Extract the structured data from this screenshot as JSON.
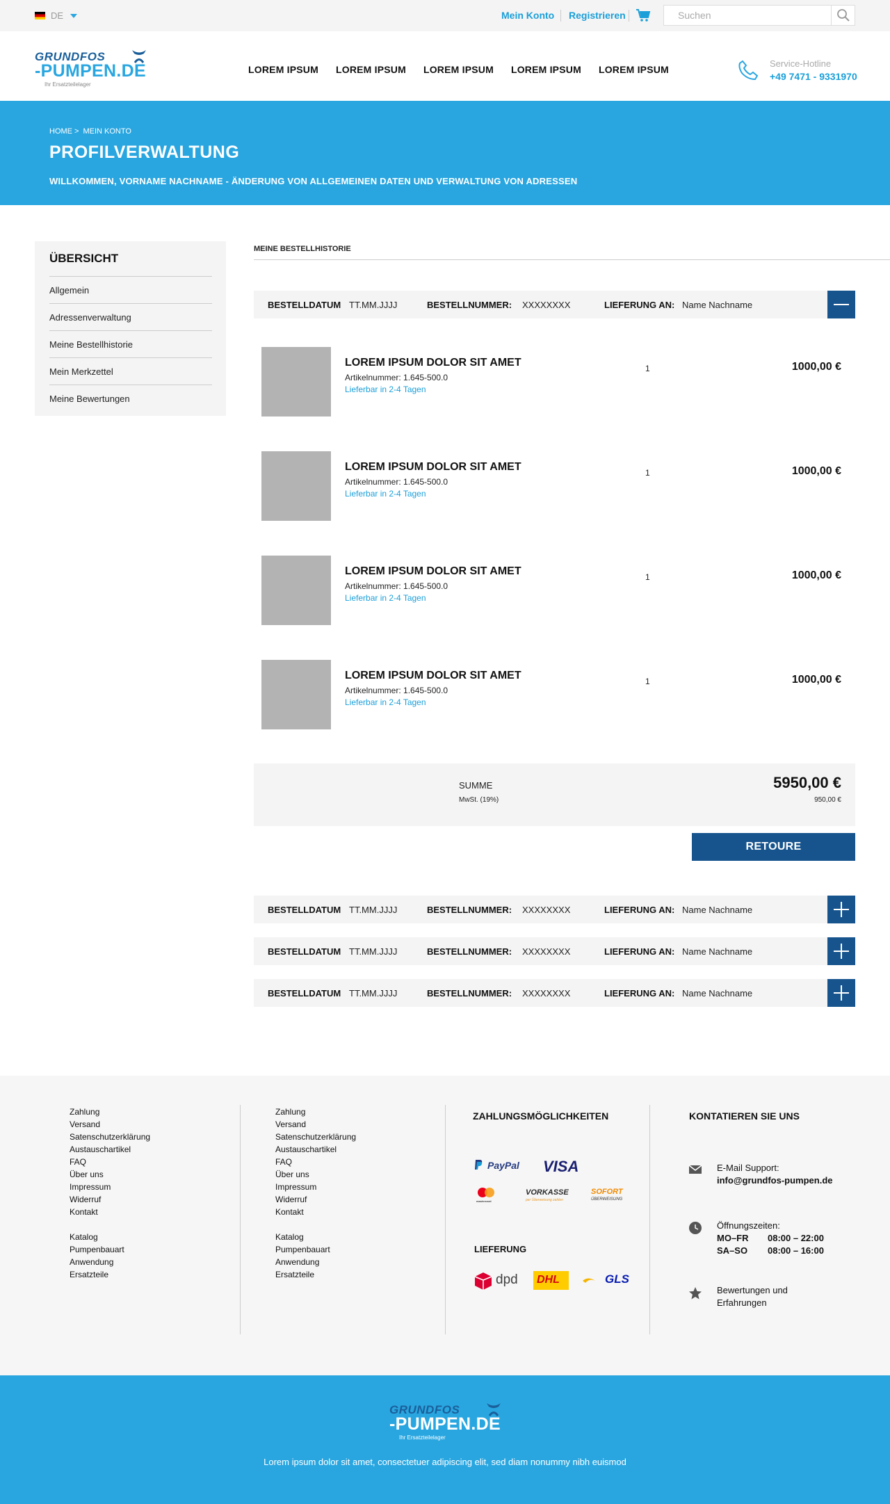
{
  "topbar": {
    "language": "DE",
    "account_link": "Mein Konto",
    "register_link": "Registrieren",
    "search_placeholder": "Suchen"
  },
  "header": {
    "logo": {
      "line1": "GRUNDFOS",
      "line2": "-PUMPEN.DE",
      "tagline": "Ihr Ersatzteilelager"
    },
    "nav": [
      "LOREM IPSUM",
      "LOREM IPSUM",
      "LOREM IPSUM",
      "LOREM IPSUM",
      "LOREM IPSUM"
    ],
    "hotline_label": "Service-Hotline",
    "hotline_number": "+49 7471 - 9331970"
  },
  "hero": {
    "breadcrumb": [
      "HOME >",
      "MEIN KONTO"
    ],
    "title": "PROFILVERWALTUNG",
    "subtitle": "WILLKOMMEN, VORNAME NACHNAME  - ÄNDERUNG VON ALLGEMEINEN DATEN UND VERWALTUNG VON ADRESSEN"
  },
  "sidebar": {
    "title": "ÜBERSICHT",
    "items": [
      "Allgemein",
      "Adressenverwaltung",
      "Meine Bestellhistorie",
      "Mein Merkzettel",
      "Meine Bewertungen"
    ]
  },
  "main": {
    "tab": "MEINE BESTELLHISTORIE",
    "order_labels": {
      "date": "BESTELLDATUM",
      "number": "BESTELLNUMMER:",
      "delivery": "LIEFERUNG AN:"
    },
    "orders": [
      {
        "date": "TT.MM.JJJJ",
        "number": "XXXXXXXX",
        "delivery": "Name Nachname",
        "expanded": true
      },
      {
        "date": "TT.MM.JJJJ",
        "number": "XXXXXXXX",
        "delivery": "Name Nachname",
        "expanded": false
      },
      {
        "date": "TT.MM.JJJJ",
        "number": "XXXXXXXX",
        "delivery": "Name Nachname",
        "expanded": false
      },
      {
        "date": "TT.MM.JJJJ",
        "number": "XXXXXXXX",
        "delivery": "Name Nachname",
        "expanded": false
      }
    ],
    "items": [
      {
        "title": "LOREM IPSUM DOLOR SIT AMET",
        "article": "Artikelnummer: 1.645-500.0",
        "availability": "Lieferbar in 2-4 Tagen",
        "qty": "1",
        "price": "1000,00 €"
      },
      {
        "title": "LOREM IPSUM DOLOR SIT AMET",
        "article": "Artikelnummer: 1.645-500.0",
        "availability": "Lieferbar in 2-4 Tagen",
        "qty": "1",
        "price": "1000,00 €"
      },
      {
        "title": "LOREM IPSUM DOLOR SIT AMET",
        "article": "Artikelnummer: 1.645-500.0",
        "availability": "Lieferbar in 2-4 Tagen",
        "qty": "1",
        "price": "1000,00 €"
      },
      {
        "title": "LOREM IPSUM DOLOR SIT AMET",
        "article": "Artikelnummer: 1.645-500.0",
        "availability": "Lieferbar in 2-4 Tagen",
        "qty": "1",
        "price": "1000,00 €"
      }
    ],
    "summary": {
      "label": "SUMME",
      "vat_label": "MwSt. (19%)",
      "total": "5950,00 €",
      "vat": "950,00 €"
    },
    "retoure_button": "RETOURE"
  },
  "footer": {
    "col1": {
      "group1": [
        "Zahlung",
        "Versand",
        "Satenschutzerklärung",
        "Austauschartikel",
        "FAQ",
        "Über uns",
        "Impressum",
        "Widerruf",
        "Kontakt"
      ],
      "group2": [
        "Katalog",
        "Pumpenbauart",
        "Anwendung",
        "Ersatzteile"
      ]
    },
    "col2": {
      "group1": [
        "Zahlung",
        "Versand",
        "Satenschutzerklärung",
        "Austauschartikel",
        "FAQ",
        "Über uns",
        "Impressum",
        "Widerruf",
        "Kontakt"
      ],
      "group2": [
        "Katalog",
        "Pumpenbauart",
        "Anwendung",
        "Ersatzteile"
      ]
    },
    "payment_heading": "ZAHLUNGSMÖGLICHKEITEN",
    "payment_logos": {
      "paypal": "PayPal",
      "visa": "VISA",
      "mastercard": "mastercard",
      "vorkasse": "VORKASSE",
      "vorkasse_sub": "per Überweisung zahlen",
      "sofort": "SOFORT",
      "sofort_sub": "ÜBERWEISUNG"
    },
    "delivery_heading": "LIEFERUNG",
    "delivery_logos": {
      "dpd": "dpd",
      "dhl": "DHL",
      "gls": "GLS"
    },
    "contact_heading": "KONTATIEREN SIE UNS",
    "email_label": "E-Mail Support:",
    "email": "info@grundfos-pumpen.de",
    "hours_label": "Öffnungszeiten:",
    "hours": [
      {
        "days": "MO–FR",
        "time": "08:00 – 22:00"
      },
      {
        "days": "SA–SO",
        "time": "08:00 – 16:00"
      }
    ],
    "reviews": [
      "Bewertungen und",
      "Erfahrungen"
    ]
  },
  "bottom": {
    "tagline": "Lorem ipsum dolor sit amet, consectetuer adipiscing elit, sed diam nonummy nibh euismod"
  },
  "colors": {
    "primary": "#29a6e0",
    "dark": "#17548e",
    "placeholder": "#b3b3b3"
  }
}
